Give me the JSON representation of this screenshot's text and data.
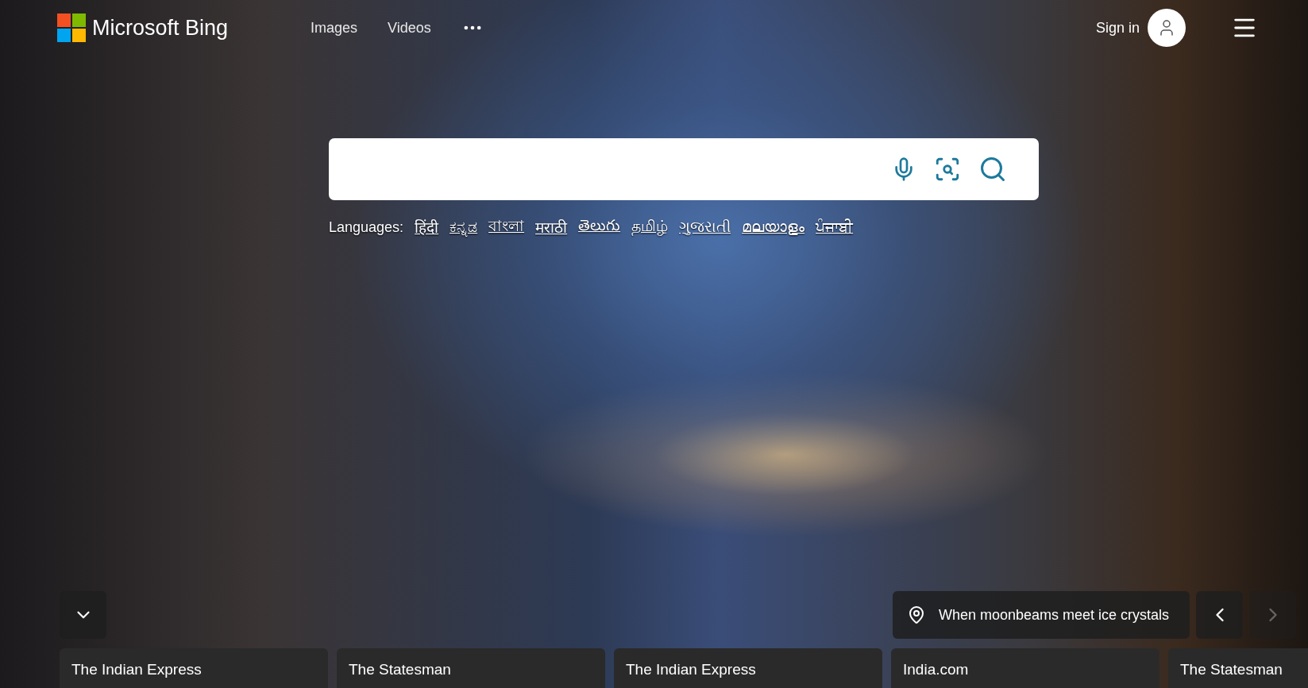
{
  "header": {
    "logo": "Microsoft Bing",
    "nav": [
      {
        "label": "Images"
      },
      {
        "label": "Videos"
      }
    ],
    "sign_in": "Sign in"
  },
  "languages": {
    "label": "Languages:",
    "items": [
      "हिंदी",
      "ಕನ್ನಡ",
      "বাংলা",
      "मराठी",
      "తెలుగు",
      "தமிழ்",
      "ગુજરાતી",
      "മലയാളം",
      "ਪੰਜਾਬੀ"
    ]
  },
  "caption": "When moonbeams meet ice crystals",
  "carousel": [
    {
      "kind": "prev",
      "disabled": false
    },
    {
      "kind": "next",
      "disabled": true
    }
  ],
  "news": [
    {
      "source": "The Indian Express"
    },
    {
      "source": "The Statesman"
    },
    {
      "source": "The Indian Express"
    },
    {
      "source": "India.com"
    },
    {
      "source": "The Statesman"
    }
  ]
}
